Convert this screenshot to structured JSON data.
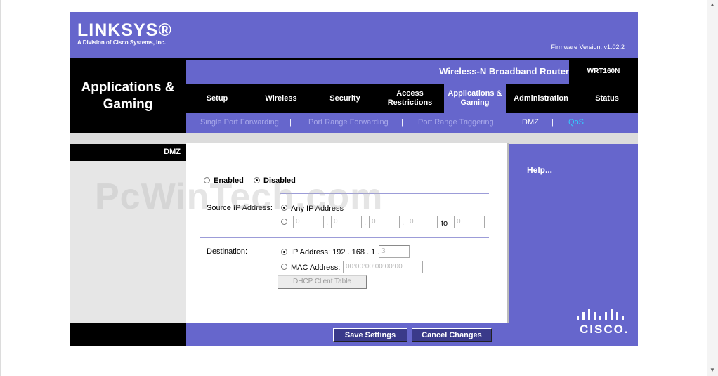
{
  "brand": {
    "logo": "LINKSYS®",
    "tagline": "A Division of Cisco Systems, Inc.",
    "firmware": "Firmware Version: v1.02.2",
    "cisco_logo": "CISCO."
  },
  "header": {
    "section_title_line1": "Applications &",
    "section_title_line2": "Gaming",
    "product_name": "Wireless-N Broadband Router",
    "model": "WRT160N"
  },
  "tabs": [
    {
      "label1": "Setup",
      "label2": ""
    },
    {
      "label1": "Wireless",
      "label2": ""
    },
    {
      "label1": "Security",
      "label2": ""
    },
    {
      "label1": "Access",
      "label2": "Restrictions"
    },
    {
      "label1": "Applications &",
      "label2": "Gaming"
    },
    {
      "label1": "Administration",
      "label2": ""
    },
    {
      "label1": "Status",
      "label2": ""
    }
  ],
  "active_tab": "Applications & Gaming",
  "subtabs": [
    "Single Port Forwarding",
    "Port Range Forwarding",
    "Port Range Triggering",
    "DMZ",
    "QoS"
  ],
  "subtab_separator": "|",
  "left_panel_label": "DMZ",
  "help_link": "Help...",
  "dmz": {
    "enabled_label": "Enabled",
    "disabled_label": "Disabled",
    "selected": "Disabled",
    "source_label": "Source IP Address:",
    "any_ip_label": "Any IP Address",
    "source_range": [
      "0",
      "0",
      "0",
      "0",
      "0"
    ],
    "to_label": "to",
    "destination_label": "Destination:",
    "ip_address_label": "IP Address: 192 . 168 . 1 .",
    "ip_last_octet": "3",
    "mac_address_label": "MAC Address:",
    "mac_value": "00:00:00:00:00:00",
    "dhcp_button": "DHCP Client Table"
  },
  "actions": {
    "save": "Save Settings",
    "cancel": "Cancel Changes"
  },
  "watermark": "PcWinTech.com",
  "colors": {
    "brand_purple": "#6666cc",
    "black": "#000000",
    "qos_highlight": "#33ccff"
  }
}
